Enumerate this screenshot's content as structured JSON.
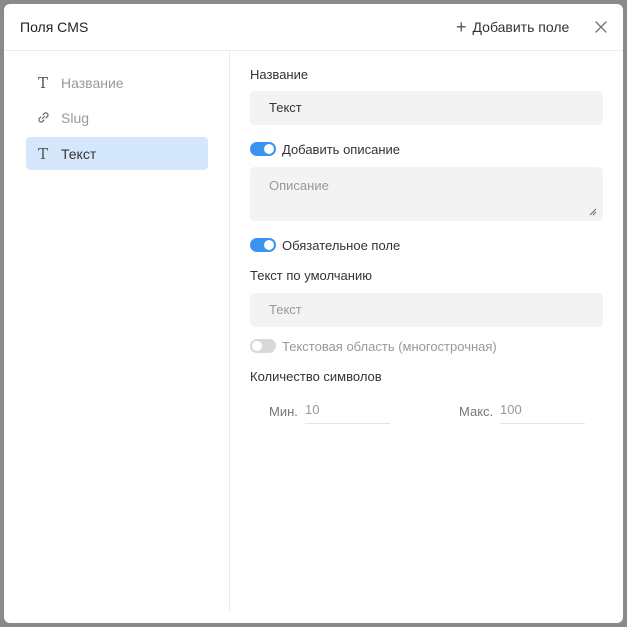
{
  "header": {
    "title": "Поля CMS",
    "add_field_label": "Добавить поле"
  },
  "sidebar": {
    "items": [
      {
        "label": "Название",
        "icon": "text-type-icon"
      },
      {
        "label": "Slug",
        "icon": "link-icon"
      },
      {
        "label": "Текст",
        "icon": "text-type-icon",
        "active": true
      }
    ]
  },
  "form": {
    "name_label": "Название",
    "name_value": "Текст",
    "add_description_label": "Добавить описание",
    "add_description_on": true,
    "description_placeholder": "Описание",
    "required_label": "Обязательное поле",
    "required_on": true,
    "default_label": "Текст по умолчанию",
    "default_placeholder": "Текст",
    "multiline_label": "Текстовая область (многострочная)",
    "multiline_on": false,
    "char_count_label": "Количество символов",
    "min_label": "Мин.",
    "min_value": "10",
    "max_label": "Макс.",
    "max_value": "100"
  },
  "colors": {
    "accent": "#3b93ef",
    "active_item_bg": "#d5e8fb",
    "field_bg": "#f3f3f3"
  }
}
